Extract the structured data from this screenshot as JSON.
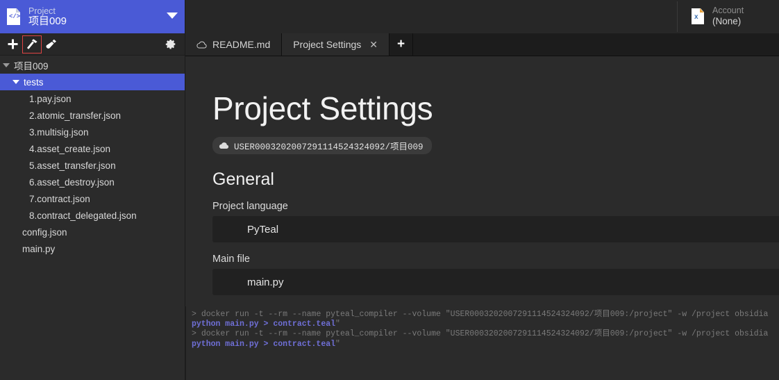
{
  "sidebar": {
    "project": {
      "icon": "code-file-icon",
      "label": "Project",
      "name": "项目009",
      "dropdown_icon": "chevron-down-icon"
    },
    "toolbar": {
      "add_icon": "plus-icon",
      "build_icon": "hammer-icon",
      "test_icon": "test-tube-icon",
      "settings_icon": "gear-icon"
    },
    "tree": [
      {
        "label": "项目009",
        "level": 0,
        "type": "folder",
        "expanded": true,
        "selected": false
      },
      {
        "label": "tests",
        "level": 1,
        "type": "folder",
        "expanded": true,
        "selected": true
      },
      {
        "label": "1.pay.json",
        "level": 2,
        "type": "file",
        "selected": false
      },
      {
        "label": "2.atomic_transfer.json",
        "level": 2,
        "type": "file",
        "selected": false
      },
      {
        "label": "3.multisig.json",
        "level": 2,
        "type": "file",
        "selected": false
      },
      {
        "label": "4.asset_create.json",
        "level": 2,
        "type": "file",
        "selected": false
      },
      {
        "label": "5.asset_transfer.json",
        "level": 2,
        "type": "file",
        "selected": false
      },
      {
        "label": "6.asset_destroy.json",
        "level": 2,
        "type": "file",
        "selected": false
      },
      {
        "label": "7.contract.json",
        "level": 2,
        "type": "file",
        "selected": false
      },
      {
        "label": "8.contract_delegated.json",
        "level": 2,
        "type": "file",
        "selected": false
      },
      {
        "label": "config.json",
        "level": 1,
        "type": "file",
        "selected": false
      },
      {
        "label": "main.py",
        "level": 1,
        "type": "file",
        "selected": false
      }
    ]
  },
  "topbar": {
    "account": {
      "icon": "spreadsheet-file-icon",
      "label": "Account",
      "value": "(None)"
    }
  },
  "tabs": [
    {
      "label": "README.md",
      "icon": "cloud-icon",
      "active": false,
      "closable": false
    },
    {
      "label": "Project Settings",
      "icon": "",
      "active": true,
      "closable": true,
      "close_icon": "close-icon"
    }
  ],
  "new_tab_icon": "plus-icon",
  "main": {
    "title": "Project Settings",
    "breadcrumb": {
      "icon": "cloud-icon",
      "text": "USER00032020072911145243​24092/项目009"
    },
    "section_title": "General",
    "fields": [
      {
        "label": "Project language",
        "value": "PyTeal"
      },
      {
        "label": "Main file",
        "value": "main.py"
      }
    ]
  },
  "console": {
    "lines": [
      {
        "prompt": "> ",
        "dim_prefix": "docker run -t --rm --name pyteal_compiler --volume \"USER00032020072911145243​24092/项目009:/project\" -w /project obsidia",
        "cmd": "",
        "suffix": ""
      },
      {
        "prompt": "",
        "dim_prefix": "",
        "cmd": "python main.py > contract.teal",
        "suffix": "\""
      },
      {
        "prompt": "> ",
        "dim_prefix": "docker run -t --rm --name pyteal_compiler --volume \"USER00032020072911145243​24092/项目009:/project\" -w /project obsidia",
        "cmd": "",
        "suffix": ""
      },
      {
        "prompt": "",
        "dim_prefix": "",
        "cmd": "python main.py > contract.teal",
        "suffix": "\""
      }
    ]
  },
  "colors": {
    "accent": "#4a5ad6",
    "sidebar_bg": "#2b2b2b",
    "toolbar_bg": "#272727",
    "field_bg": "#212121",
    "console_cmd": "#6f6fd6",
    "console_dim": "#7a7a7a",
    "selection_outline": "#e04343"
  }
}
